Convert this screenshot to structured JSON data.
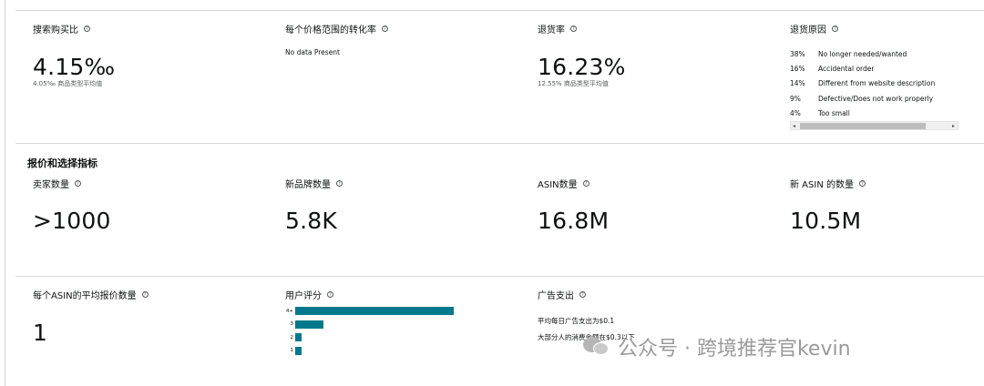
{
  "conversion": {
    "label": "搜索购买比",
    "value": "4.15‰",
    "category_avg": "4.05‰ 商品类型平均值"
  },
  "price_range": {
    "label": "每个价格范围的转化率",
    "text": "No data Present"
  },
  "return_rate": {
    "label": "退货率",
    "value": "16.23%",
    "category_avg": "12.55% 商品类型平均值"
  },
  "return_reasons": {
    "label": "退货原因",
    "items": [
      {
        "pct": "38%",
        "reason": "No longer needed/wanted"
      },
      {
        "pct": "16%",
        "reason": "Accidental order"
      },
      {
        "pct": "14%",
        "reason": "Different from website description"
      },
      {
        "pct": "9%",
        "reason": "Defective/Does not work properly"
      },
      {
        "pct": "4%",
        "reason": "Too small"
      }
    ],
    "scroll_left": "◂",
    "scroll_right": "▸"
  },
  "offer_section": {
    "title": "报价和选择指标",
    "sellers": {
      "label": "卖家数量",
      "value": ">1000"
    },
    "new_brands": {
      "label": "新品牌数量",
      "value": "5.8K"
    },
    "asins": {
      "label": "ASIN数量",
      "value": "16.8M"
    },
    "new_asins": {
      "label": "新 ASIN 的数量",
      "value": "10.5M"
    },
    "avg_offers": {
      "label": "每个ASIN的平均报价数量",
      "value": "1"
    },
    "rating": {
      "label": "用户评分",
      "chart_data": {
        "type": "bar",
        "orientation": "horizontal",
        "categories": [
          "4+",
          "3",
          "2",
          "1"
        ],
        "values": [
          100,
          18,
          4,
          4
        ],
        "unit": "relative"
      }
    },
    "ad_spend": {
      "label": "广告支出",
      "line1": "平均每日广告支出为$0.1",
      "line2": "大部分人的消费金额在$0.3以下"
    }
  },
  "help_glyph": "?",
  "watermark": "公众号 · 跨境推荐官kevin"
}
